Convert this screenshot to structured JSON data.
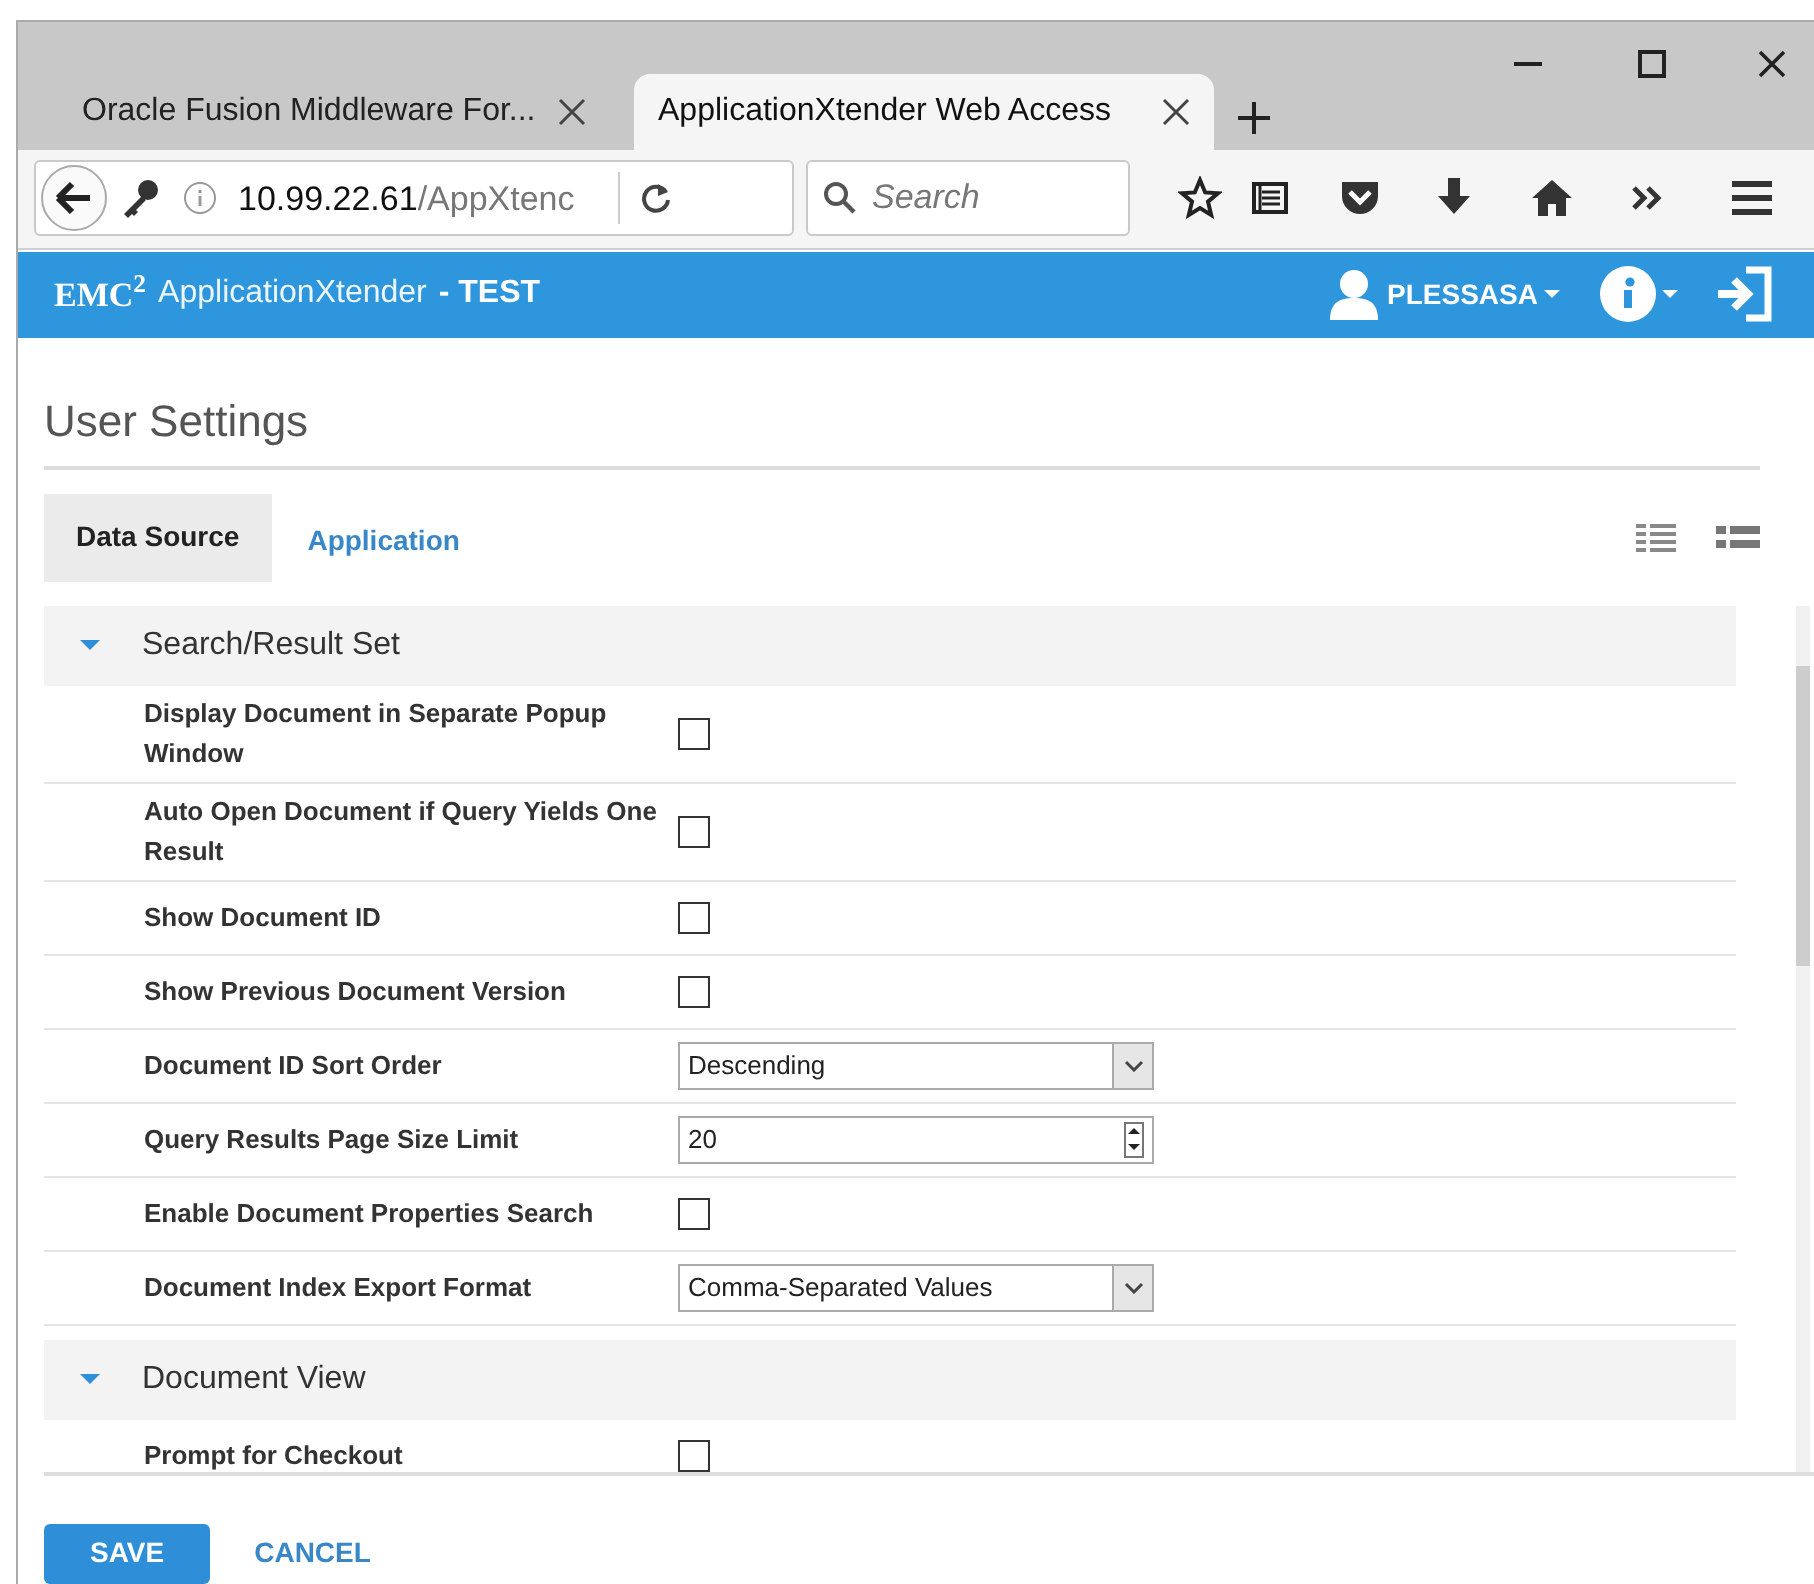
{
  "browser": {
    "tabs": [
      {
        "label": "Oracle Fusion Middleware For...",
        "selected": false
      },
      {
        "label": "ApplicationXtender Web Access",
        "selected": true
      }
    ],
    "address": {
      "host": "10.99.22.61",
      "path": "/AppXtenc"
    },
    "search": {
      "placeholder": "Search"
    }
  },
  "app_bar": {
    "brand": "EMC",
    "brand_sup": "2",
    "product": "ApplicationXtender",
    "environment": "- TEST",
    "user": "PLESSASA"
  },
  "page_title": "User Settings",
  "tabs": [
    {
      "label": "Data Source",
      "selected": true
    },
    {
      "label": "Application",
      "selected": false
    }
  ],
  "sections": [
    {
      "title": "Search/Result Set",
      "expanded": true,
      "rows": [
        {
          "label": "Display Document in Separate Popup Window",
          "kind": "checkbox",
          "checked": false
        },
        {
          "label": "Auto Open Document if Query Yields One Result",
          "kind": "checkbox",
          "checked": false
        },
        {
          "label": "Show Document ID",
          "kind": "checkbox",
          "checked": false
        },
        {
          "label": "Show Previous Document Version",
          "kind": "checkbox",
          "checked": false
        },
        {
          "label": "Document ID Sort Order",
          "kind": "select",
          "value": "Descending"
        },
        {
          "label": "Query Results Page Size Limit",
          "kind": "number",
          "value": "20"
        },
        {
          "label": "Enable Document Properties Search",
          "kind": "checkbox",
          "checked": false
        },
        {
          "label": "Document Index Export Format",
          "kind": "select",
          "value": "Comma-Separated Values"
        }
      ]
    },
    {
      "title": "Document View",
      "expanded": true,
      "rows": [
        {
          "label": "Prompt for Checkout",
          "kind": "checkbox",
          "checked": false
        }
      ]
    }
  ],
  "buttons": [
    {
      "label": "SAVE",
      "kind": "primary"
    },
    {
      "label": "CANCEL",
      "kind": "link"
    }
  ]
}
